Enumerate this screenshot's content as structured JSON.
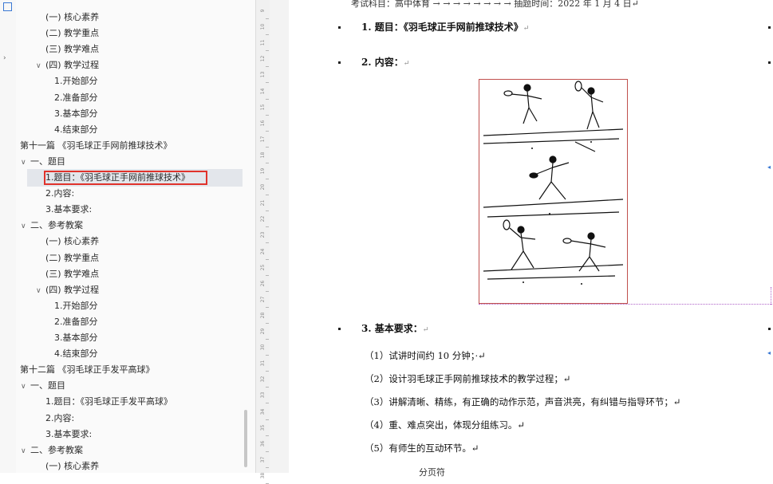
{
  "nav": {
    "items": [
      {
        "label": "(一) 核心素养",
        "level": 3,
        "chevron": ""
      },
      {
        "label": "(二) 教学重点",
        "level": 3,
        "chevron": ""
      },
      {
        "label": "(三) 教学难点",
        "level": 3,
        "chevron": ""
      },
      {
        "label": "(四) 教学过程",
        "level": 3,
        "chevron": "expanded"
      },
      {
        "label": "1.开始部分",
        "level": 4,
        "chevron": ""
      },
      {
        "label": "2.准备部分",
        "level": 4,
        "chevron": ""
      },
      {
        "label": "3.基本部分",
        "level": 4,
        "chevron": ""
      },
      {
        "label": "4.结束部分",
        "level": 4,
        "chevron": ""
      },
      {
        "label": "第十一篇 《羽毛球正手网前推球技术》",
        "level": 1,
        "chevron": "expanded"
      },
      {
        "label": "一、题目",
        "level": 2,
        "chevron": "expanded"
      },
      {
        "label": "1.题目：《羽毛球正手网前推球技术》",
        "level": 3,
        "chevron": "",
        "selected": true
      },
      {
        "label": "2.内容:",
        "level": 3,
        "chevron": ""
      },
      {
        "label": "3.基本要求:",
        "level": 3,
        "chevron": ""
      },
      {
        "label": "二、参考教案",
        "level": 2,
        "chevron": "expanded"
      },
      {
        "label": "(一) 核心素养",
        "level": 3,
        "chevron": ""
      },
      {
        "label": "(二) 教学重点",
        "level": 3,
        "chevron": ""
      },
      {
        "label": "(三) 教学难点",
        "level": 3,
        "chevron": ""
      },
      {
        "label": "(四) 教学过程",
        "level": 3,
        "chevron": "expanded"
      },
      {
        "label": "1.开始部分",
        "level": 4,
        "chevron": ""
      },
      {
        "label": "2.准备部分",
        "level": 4,
        "chevron": ""
      },
      {
        "label": "3.基本部分",
        "level": 4,
        "chevron": ""
      },
      {
        "label": "4.结束部分",
        "level": 4,
        "chevron": ""
      },
      {
        "label": "第十二篇 《羽毛球正手发平高球》",
        "level": 1,
        "chevron": "expanded"
      },
      {
        "label": "一、题目",
        "level": 2,
        "chevron": "expanded"
      },
      {
        "label": "1.题目：《羽毛球正手发平高球》",
        "level": 3,
        "chevron": ""
      },
      {
        "label": "2.内容:",
        "level": 3,
        "chevron": ""
      },
      {
        "label": "3.基本要求:",
        "level": 3,
        "chevron": ""
      },
      {
        "label": "二、参考教案",
        "level": 2,
        "chevron": "expanded"
      },
      {
        "label": "(一) 核心素养",
        "level": 3,
        "chevron": ""
      }
    ]
  },
  "ruler": {
    "numbers": [
      "9",
      "10",
      "11",
      "12",
      "13",
      "14",
      "15",
      "16",
      "17",
      "18",
      "19",
      "20",
      "21",
      "22",
      "23",
      "24",
      "25",
      "26",
      "27",
      "28",
      "29",
      "30",
      "31",
      "32",
      "33",
      "34",
      "35",
      "36",
      "37",
      "38"
    ]
  },
  "doc": {
    "header_line": "考试科目：高中体育 → → → → → → → → 抽题时间：2022 年 1 月 4 日↵",
    "title": "1. 题目：《羽毛球正手网前推球技术》",
    "title_mark": "↵",
    "content_heading": "2. 内容：",
    "content_mark": "↵",
    "requirements_heading": "3. 基本要求：",
    "requirements_mark": "↵",
    "requirements": [
      "（1）试讲时间约 10 分钟；·↵",
      "（2）设计羽毛球正手网前推球技术的教学过程；↵",
      "（3）讲解清晰、精练，有正确的动作示范，声音洪亮，有纠错与指导环节；↵",
      "（4）重、难点突出，体现分组练习。↵",
      "（5）有师生的互动环节。↵"
    ],
    "footer_partial": "分页符"
  },
  "icons": {
    "chevron_expanded": "∨",
    "bullet": "■"
  },
  "colors": {
    "selection_border": "#e0322b",
    "selection_bg": "#e3e6eb",
    "nav_bg": "#fafafa",
    "figure_border": "#c0504d",
    "section_break": "#b063c9"
  }
}
